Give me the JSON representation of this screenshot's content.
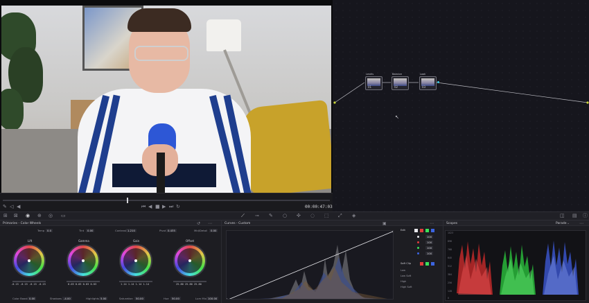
{
  "viewer": {
    "timecode": "00:00:47:03",
    "playhead_fraction": 0.38
  },
  "nodes": [
    {
      "num": "01",
      "label": "Levels"
    },
    {
      "num": "02",
      "label": "Balance"
    },
    {
      "num": "03",
      "label": "Look"
    }
  ],
  "primaries": {
    "title": "Primaries - Color Wheels",
    "top_fields": [
      {
        "label": "Temp",
        "value": "0.0"
      },
      {
        "label": "Tint",
        "value": "0.00"
      },
      {
        "label": "Contrast",
        "value": "1.210"
      },
      {
        "label": "Pivot",
        "value": "0.435"
      },
      {
        "label": "Mid/Detail",
        "value": "0.00"
      }
    ],
    "wheels": [
      {
        "name": "Lift",
        "values": "-0.15  -0.15  -0.15  -0.15"
      },
      {
        "name": "Gamma",
        "values": "0.03  0.03  0.03  0.03"
      },
      {
        "name": "Gain",
        "values": "1.14  1.14  1.14  1.14"
      },
      {
        "name": "Offset",
        "values": "25.80  25.80  25.80"
      }
    ],
    "bottom_fields": [
      {
        "label": "Color Boost",
        "value": "0.00"
      },
      {
        "label": "Shadows",
        "value": "-4.00"
      },
      {
        "label": "Highlights",
        "value": "5.00"
      },
      {
        "label": "Saturation",
        "value": "50.00"
      },
      {
        "label": "Hue",
        "value": "50.00"
      },
      {
        "label": "Lum Mix",
        "value": "100.00"
      }
    ]
  },
  "curves": {
    "title": "Curves - Custom",
    "edit_label": "Edit",
    "channels": [
      "100",
      "100",
      "100",
      "100"
    ],
    "softclip_label": "Soft Clip",
    "softclip_items": [
      "Low",
      "Low Soft",
      "High",
      "High Soft"
    ]
  },
  "scopes": {
    "title": "Scopes",
    "mode": "Parade",
    "scale": [
      "1023",
      "896",
      "768",
      "640",
      "512",
      "384",
      "256",
      "128",
      "0"
    ]
  },
  "colors": {
    "accent_red": "#e03c3c",
    "accent_green": "#3ce05a",
    "accent_blue": "#3c64e0",
    "node_port": "#39c7e0"
  }
}
